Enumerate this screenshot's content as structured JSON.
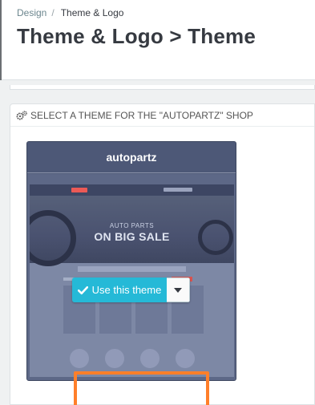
{
  "breadcrumb": {
    "parent": "Design",
    "separator": "/",
    "current": "Theme & Logo"
  },
  "page": {
    "title": "Theme & Logo > Theme"
  },
  "panel": {
    "heading": "SELECT A THEME FOR THE \"AUTOPARTZ\" SHOP",
    "heading_icon": "cogs-icon"
  },
  "theme_card": {
    "name": "autopartz",
    "preview": {
      "hero_subtitle": "AUTO PARTS",
      "hero_title": "ON BIG SALE"
    },
    "use_button_label": "Use this theme",
    "use_button_icon": "check-icon",
    "dropdown_icon": "caret-down-icon"
  },
  "colors": {
    "accent": "#25b9d7",
    "highlight_outline": "#ff7f2a",
    "card_background": "#4f5b79"
  }
}
